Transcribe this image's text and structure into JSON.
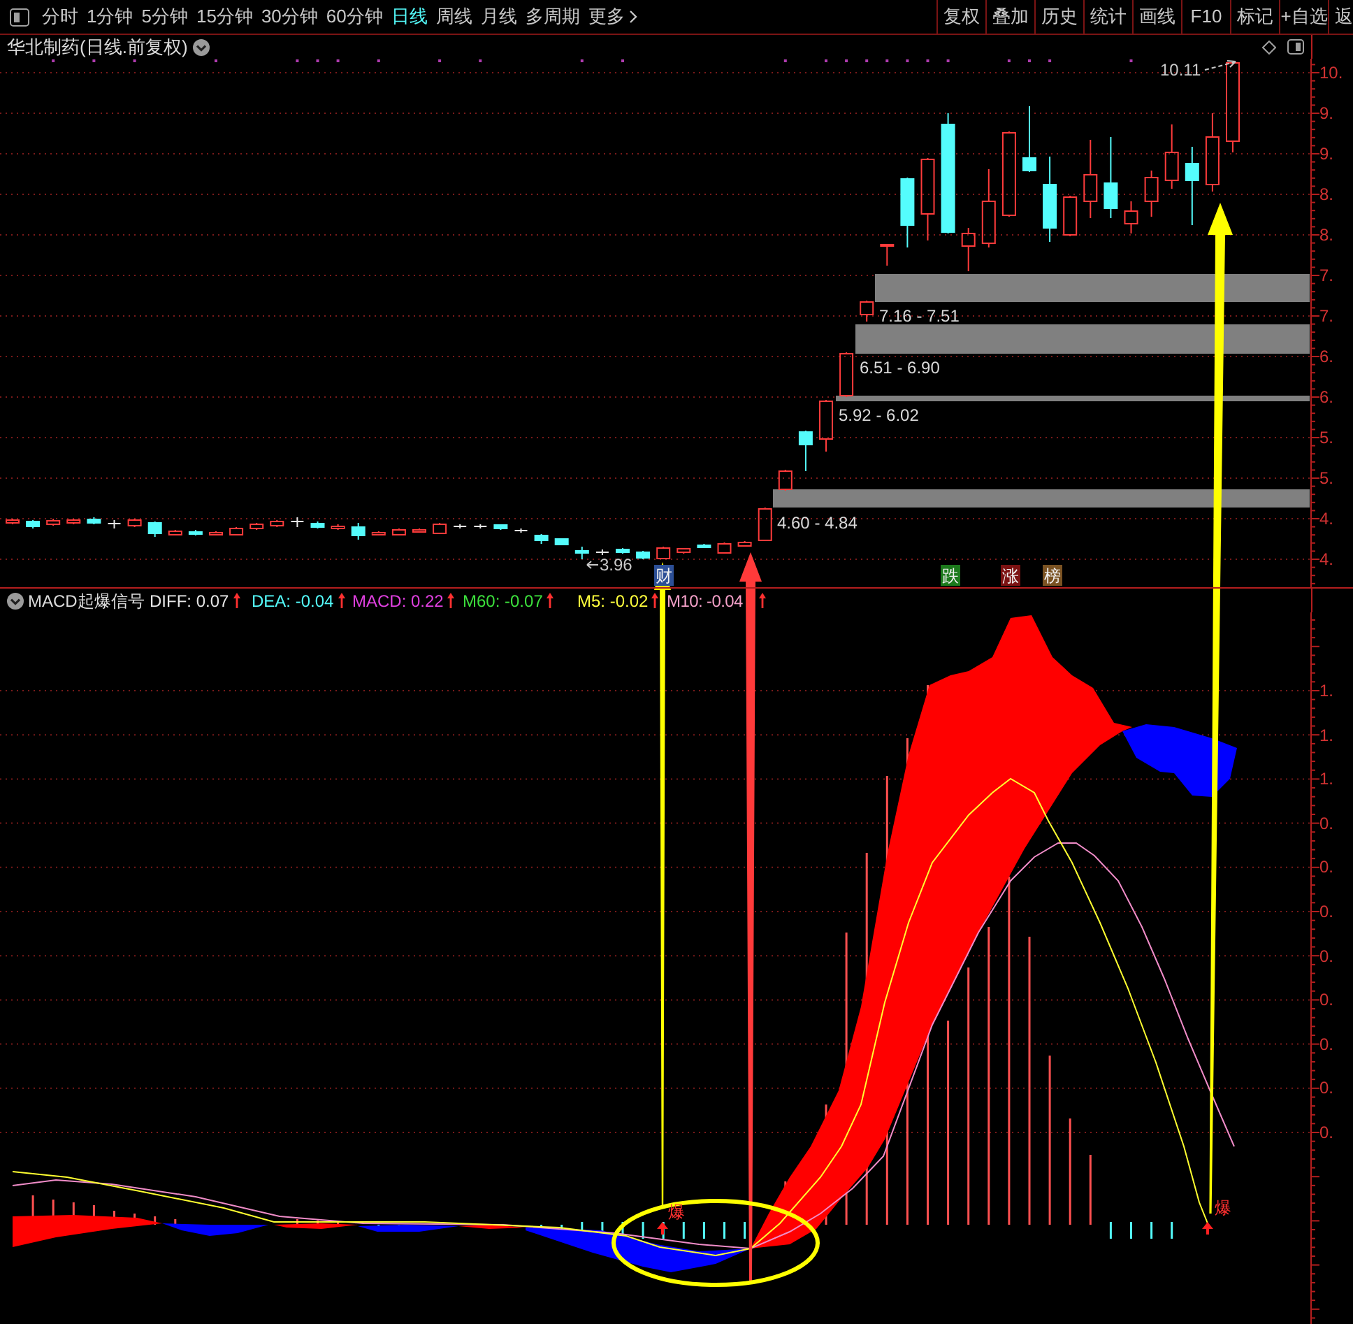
{
  "toolbar": {
    "periods": [
      {
        "label": "分时",
        "kind": "period",
        "selected": false
      },
      {
        "label": "1分钟",
        "kind": "period",
        "selected": false
      },
      {
        "label": "5分钟",
        "kind": "period",
        "selected": false
      },
      {
        "label": "15分钟",
        "kind": "period",
        "selected": false
      },
      {
        "label": "30分钟",
        "kind": "period",
        "selected": false
      },
      {
        "label": "60分钟",
        "kind": "period",
        "selected": false
      },
      {
        "label": "日线",
        "kind": "period",
        "selected": true
      },
      {
        "label": "周线",
        "kind": "period",
        "selected": false
      },
      {
        "label": "月线",
        "kind": "period",
        "selected": false
      },
      {
        "label": "多周期",
        "kind": "period",
        "selected": false
      },
      {
        "label": "更多",
        "kind": "menu",
        "selected": false
      }
    ],
    "tools": [
      "复权",
      "叠加",
      "历史",
      "统计",
      "画线",
      "F10",
      "标记",
      "+自选",
      "返"
    ]
  },
  "chart_header": {
    "title": "华北制药(日线.前复权)"
  },
  "price_chart": {
    "axis_labels": [
      "10.",
      "9.",
      "9.",
      "8.",
      "8.",
      "7.",
      "7.",
      "6.",
      "6.",
      "5.",
      "5.",
      "4.",
      "4."
    ],
    "zones": [
      "7.16 - 7.51",
      "6.51 - 6.90",
      "5.92 - 6.02",
      "4.60 - 4.84"
    ],
    "annotations": [
      {
        "kind": "high",
        "label": "10.11"
      },
      {
        "kind": "low",
        "label": "3.96"
      }
    ],
    "tags": [
      {
        "label": "财",
        "color": "#2c4f96"
      },
      {
        "label": "跌",
        "color": "#1c7a1c"
      },
      {
        "label": "涨",
        "color": "#7c1212"
      },
      {
        "label": "榜",
        "color": "#7a5222"
      }
    ]
  },
  "indicator": {
    "name": "MACD起爆信号",
    "values": [
      {
        "label": "DIFF: 0.07",
        "color": "#e6e6e6",
        "rising": true
      },
      {
        "label": "DEA: -0.04",
        "color": "#54fcfc",
        "rising": true
      },
      {
        "label": "MACD: 0.22",
        "color": "#e040e0",
        "rising": true
      },
      {
        "label": "M60: -0.07",
        "color": "#3ce03c",
        "rising": true
      },
      {
        "label": "M5: -0.02",
        "color": "#ffff3c",
        "rising": true
      },
      {
        "label": "M10: -0.04",
        "color": "#f4a0c8",
        "rising": true
      }
    ],
    "axis_labels": [
      "1.",
      "1.",
      "1.",
      "0.",
      "0.",
      "0.",
      "0.",
      "0.",
      "0.",
      "0.",
      "0."
    ],
    "signals": [
      {
        "label": "爆"
      },
      {
        "label": "爆"
      }
    ]
  }
}
